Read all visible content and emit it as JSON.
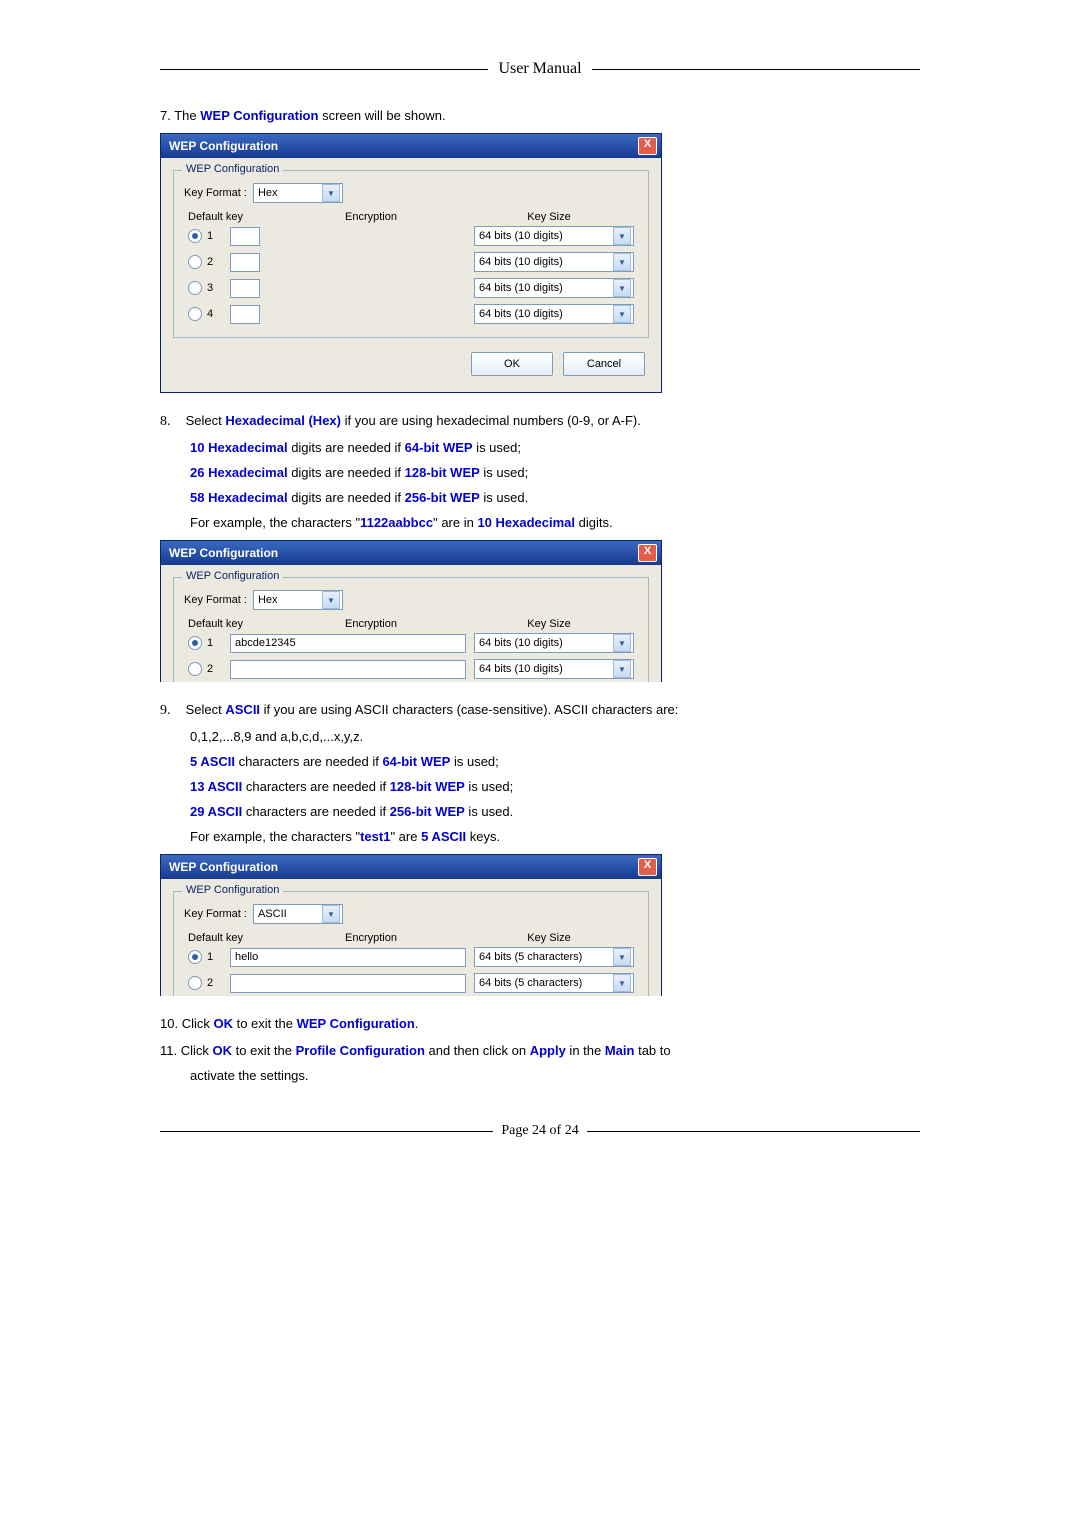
{
  "header": {
    "title": "User Manual"
  },
  "footer": {
    "page": "Page 24 of 24"
  },
  "steps": {
    "s7": {
      "num": "7.",
      "pre": "The ",
      "bold": "WEP Configuration",
      "post": " screen will be shown."
    },
    "s8": {
      "num": "8.",
      "line1a": "Select ",
      "line1b": "Hexadecimal (Hex)",
      "line1c": " if you are using hexadecimal numbers (0-9, or A-F).",
      "l2a": "10 Hexadecimal",
      "l2b": " digits are needed if ",
      "l2c": "64-bit WEP",
      "l2d": " is used;",
      "l3a": "26 Hexadecimal",
      "l3b": " digits are needed if ",
      "l3c": "128-bit WEP",
      "l3d": " is used;",
      "l4a": "58 Hexadecimal",
      "l4b": " digits are needed if ",
      "l4c": "256-bit WEP",
      "l4d": " is used.",
      "l5a": "For example, the characters \"",
      "l5b": "1122aabbcc",
      "l5c": "\" are in ",
      "l5d": "10 Hexadecimal",
      "l5e": " digits."
    },
    "s9": {
      "num": "9.",
      "line1a": "Select ",
      "line1b": "ASCII",
      "line1c": " if you are using ASCII characters (case-sensitive). ASCII characters are:",
      "l1d": "0,1,2,...8,9 and a,b,c,d,...x,y,z.",
      "l2a": "5 ASCII",
      "l2b": " characters are needed if ",
      "l2c": "64-bit WEP",
      "l2d": " is used;",
      "l3a": "13 ASCII",
      "l3b": " characters are needed if ",
      "l3c": "128-bit WEP",
      "l3d": " is used;",
      "l4a": "29 ASCII",
      "l4b": " characters are needed if ",
      "l4c": "256-bit WEP",
      "l4d": " is used.",
      "l5a": "For example, the characters \"",
      "l5b": "test1",
      "l5c": "\" are ",
      "l5d": "5 ASCII",
      "l5e": " keys."
    },
    "s10": {
      "num": "10.",
      "pre": "Click ",
      "ok": "OK",
      "mid": " to exit the ",
      "bold": "WEP Configuration",
      "post": "."
    },
    "s11": {
      "num": "11.",
      "pre": "Click ",
      "ok": "OK",
      "mid": " to exit the ",
      "pc": "Profile Configuration",
      "mid2": " and then click on ",
      "apply": "Apply",
      "mid3": " in the ",
      "main": "Main",
      "post": " tab to",
      "post2": "activate the settings."
    }
  },
  "dlg": {
    "title": "WEP Configuration",
    "close": "X",
    "grouptitle": "WEP Configuration",
    "keyformat_label": "Key Format :",
    "kf_hex": "Hex",
    "kf_ascii": "ASCII",
    "col_defkey": "Default key",
    "col_enc": "Encryption",
    "col_size": "Key Size",
    "nums": {
      "1": "1",
      "2": "2",
      "3": "3",
      "4": "4"
    },
    "size10": "64 bits (10 digits)",
    "size5": "64 bits (5 characters)",
    "enc_abcde": "abcde12345",
    "enc_hello": "hello",
    "ok": "OK",
    "cancel": "Cancel"
  }
}
